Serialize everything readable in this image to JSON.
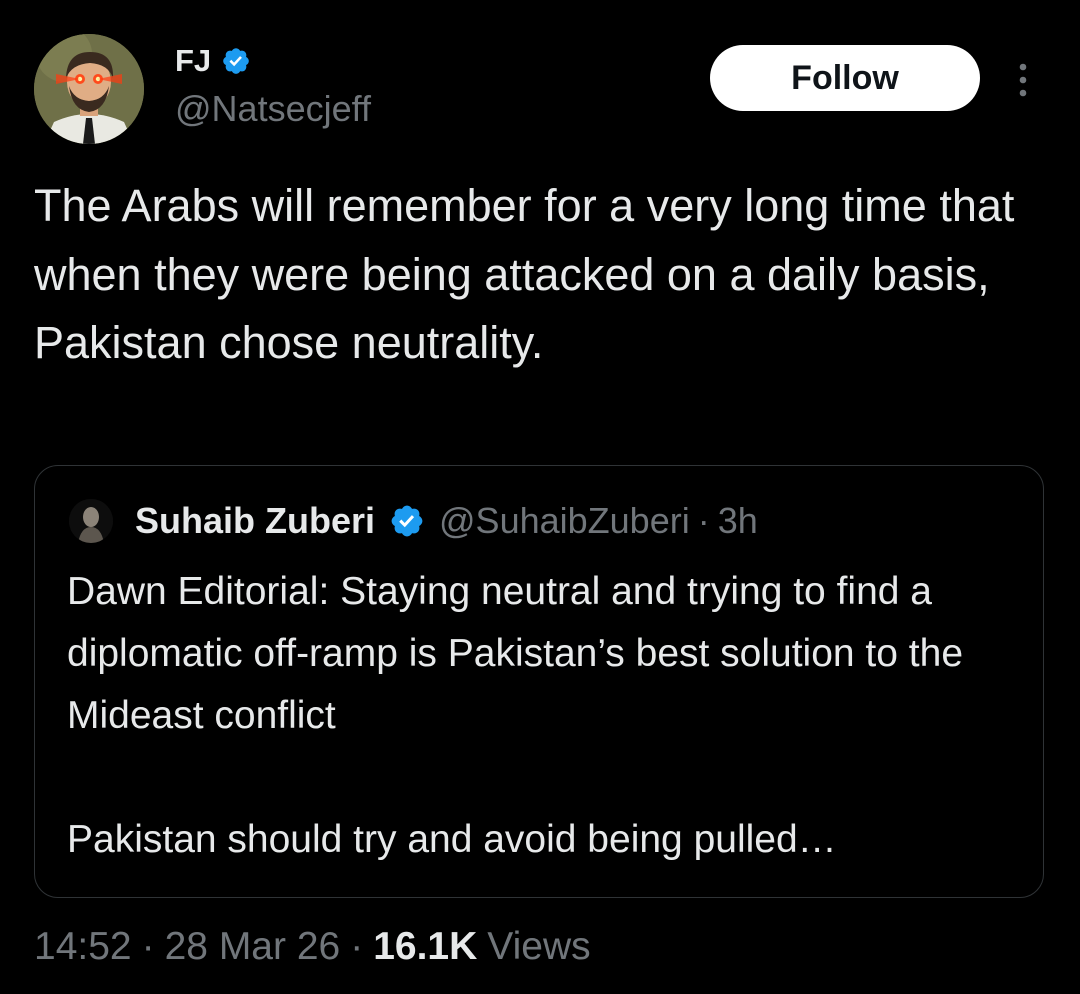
{
  "tweet": {
    "author": {
      "display_name": "FJ",
      "handle": "@Natsecjeff",
      "verified": true,
      "avatar_icon": "cartoon-avatar-laser-eyes"
    },
    "follow_label": "Follow",
    "more_icon": "more-vertical-icon",
    "text": "The Arabs will remember for a very long time that when they were being attacked on a daily basis, Pakistan chose neutrality.",
    "quote": {
      "display_name": "Suhaib Zuberi",
      "handle": "@SuhaibZuberi",
      "separator": "·",
      "time": "3h",
      "verified": true,
      "text_paragraph_1": "Dawn Editorial: Staying neutral and trying to find a diplomatic off-ramp is Pakistan’s best solution to the Mideast conflict",
      "text_paragraph_2": "Pakistan should try and avoid being pulled…"
    },
    "footer": {
      "time": "14:52",
      "separator": "·",
      "date": "28 Mar 26",
      "views_count": "16.1K",
      "views_label": "Views"
    }
  },
  "colors": {
    "background": "#000000",
    "primary_text": "#e7e9ea",
    "secondary_text": "#71767b",
    "verified_blue": "#1d9bf0",
    "border": "#2f3336",
    "follow_bg": "#ffffff"
  }
}
